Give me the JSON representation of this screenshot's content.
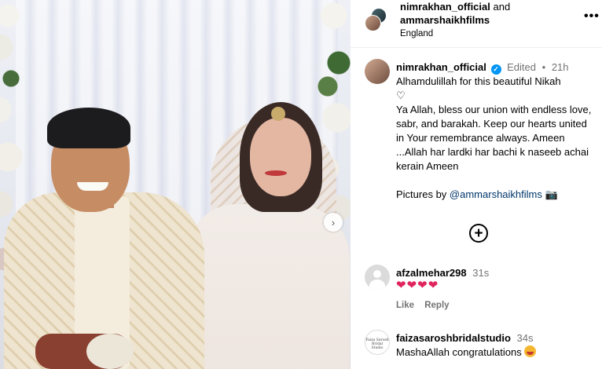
{
  "header": {
    "user1": "nimrakhan_official",
    "joiner": "and",
    "user2": "ammarshaikhfilms",
    "location": "England",
    "more_icon": "more-options-icon"
  },
  "caption": {
    "username": "nimrakhan_official",
    "verified_icon": "verified-badge-icon",
    "edited": "Edited",
    "dot": "•",
    "time": "21h",
    "line1": "Alhamdulillah for this beautiful Nikah",
    "heart": "♡",
    "body": "Ya Allah, bless our union with endless love, sabr, and barakah. Keep our hearts united in Your remembrance always. Ameen ...Allah har lardki har bachi k naseeb achai kerain Ameen",
    "credits_prefix": "Pictures by ",
    "credits_mention": "@ammarshaikhfilms",
    "credits_emoji": "📷"
  },
  "add_icon": "+",
  "carousel_next": "›",
  "comments": [
    {
      "username": "afzalmehar298",
      "time": "31s",
      "text": "❤❤❤❤",
      "like": "Like",
      "reply": "Reply"
    },
    {
      "username": "faizasaroshbridalstudio",
      "time": "34s",
      "text": "MashaAllah congratulations",
      "avatar_text": "Faiza Sarosh Bridal Studio"
    }
  ],
  "colors": {
    "link": "#00376b",
    "verified": "#0095f6",
    "muted": "#737373",
    "heart": "#e0245e"
  }
}
